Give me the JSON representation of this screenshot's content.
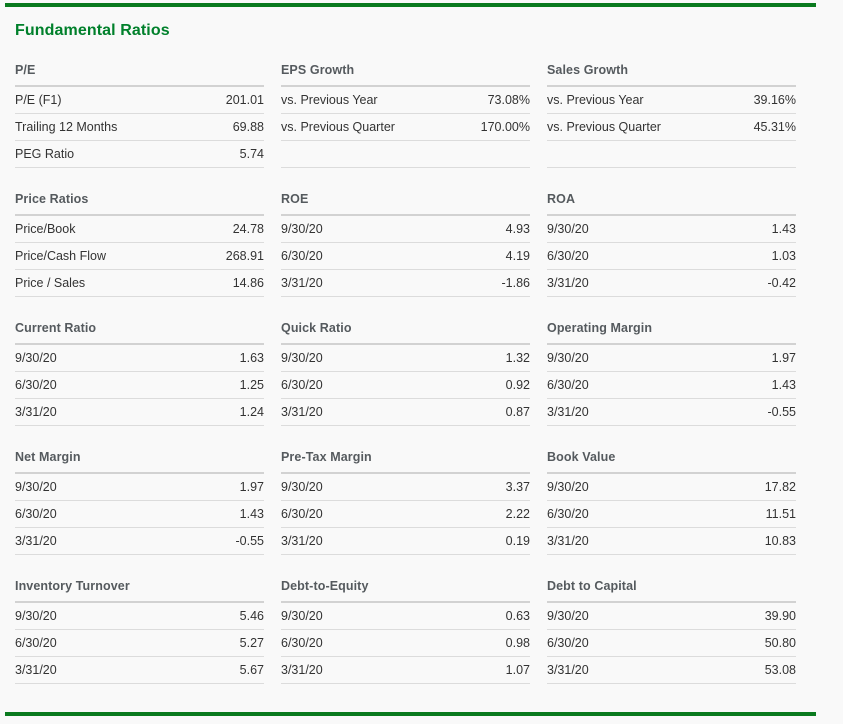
{
  "page": {
    "title": "Fundamental Ratios",
    "accent_green": "#00802b",
    "rule_green": "#0a7a1e",
    "background": "#f9f9f9",
    "header_color": "#555a5e",
    "text_color": "#333333",
    "divider_color": "#dcdcdc"
  },
  "blocks": [
    {
      "heading": "P/E",
      "rows": [
        {
          "label": "P/E (F1)",
          "value": "201.01"
        },
        {
          "label": "Trailing 12 Months",
          "value": "69.88"
        },
        {
          "label": "PEG Ratio",
          "value": "5.74"
        }
      ]
    },
    {
      "heading": "EPS Growth",
      "rows": [
        {
          "label": "vs. Previous Year",
          "value": "73.08%"
        },
        {
          "label": "vs. Previous Quarter",
          "value": "170.00%"
        },
        {
          "label": "",
          "value": ""
        }
      ]
    },
    {
      "heading": "Sales Growth",
      "rows": [
        {
          "label": "vs. Previous Year",
          "value": "39.16%"
        },
        {
          "label": "vs. Previous Quarter",
          "value": "45.31%"
        },
        {
          "label": "",
          "value": ""
        }
      ]
    },
    {
      "heading": "Price Ratios",
      "rows": [
        {
          "label": "Price/Book",
          "value": "24.78"
        },
        {
          "label": "Price/Cash Flow",
          "value": "268.91"
        },
        {
          "label": "Price / Sales",
          "value": "14.86"
        }
      ]
    },
    {
      "heading": "ROE",
      "rows": [
        {
          "label": "9/30/20",
          "value": "4.93"
        },
        {
          "label": "6/30/20",
          "value": "4.19"
        },
        {
          "label": "3/31/20",
          "value": "-1.86"
        }
      ]
    },
    {
      "heading": "ROA",
      "rows": [
        {
          "label": "9/30/20",
          "value": "1.43"
        },
        {
          "label": "6/30/20",
          "value": "1.03"
        },
        {
          "label": "3/31/20",
          "value": "-0.42"
        }
      ]
    },
    {
      "heading": "Current Ratio",
      "rows": [
        {
          "label": "9/30/20",
          "value": "1.63"
        },
        {
          "label": "6/30/20",
          "value": "1.25"
        },
        {
          "label": "3/31/20",
          "value": "1.24"
        }
      ]
    },
    {
      "heading": "Quick Ratio",
      "rows": [
        {
          "label": "9/30/20",
          "value": "1.32"
        },
        {
          "label": "6/30/20",
          "value": "0.92"
        },
        {
          "label": "3/31/20",
          "value": "0.87"
        }
      ]
    },
    {
      "heading": "Operating Margin",
      "rows": [
        {
          "label": "9/30/20",
          "value": "1.97"
        },
        {
          "label": "6/30/20",
          "value": "1.43"
        },
        {
          "label": "3/31/20",
          "value": "-0.55"
        }
      ]
    },
    {
      "heading": "Net Margin",
      "rows": [
        {
          "label": "9/30/20",
          "value": "1.97"
        },
        {
          "label": "6/30/20",
          "value": "1.43"
        },
        {
          "label": "3/31/20",
          "value": "-0.55"
        }
      ]
    },
    {
      "heading": "Pre-Tax Margin",
      "rows": [
        {
          "label": "9/30/20",
          "value": "3.37"
        },
        {
          "label": "6/30/20",
          "value": "2.22"
        },
        {
          "label": "3/31/20",
          "value": "0.19"
        }
      ]
    },
    {
      "heading": "Book Value",
      "rows": [
        {
          "label": "9/30/20",
          "value": "17.82"
        },
        {
          "label": "6/30/20",
          "value": "11.51"
        },
        {
          "label": "3/31/20",
          "value": "10.83"
        }
      ]
    },
    {
      "heading": "Inventory Turnover",
      "rows": [
        {
          "label": "9/30/20",
          "value": "5.46"
        },
        {
          "label": "6/30/20",
          "value": "5.27"
        },
        {
          "label": "3/31/20",
          "value": "5.67"
        }
      ]
    },
    {
      "heading": "Debt-to-Equity",
      "rows": [
        {
          "label": "9/30/20",
          "value": "0.63"
        },
        {
          "label": "6/30/20",
          "value": "0.98"
        },
        {
          "label": "3/31/20",
          "value": "1.07"
        }
      ]
    },
    {
      "heading": "Debt to Capital",
      "rows": [
        {
          "label": "9/30/20",
          "value": "39.90"
        },
        {
          "label": "6/30/20",
          "value": "50.80"
        },
        {
          "label": "3/31/20",
          "value": "53.08"
        }
      ]
    }
  ]
}
